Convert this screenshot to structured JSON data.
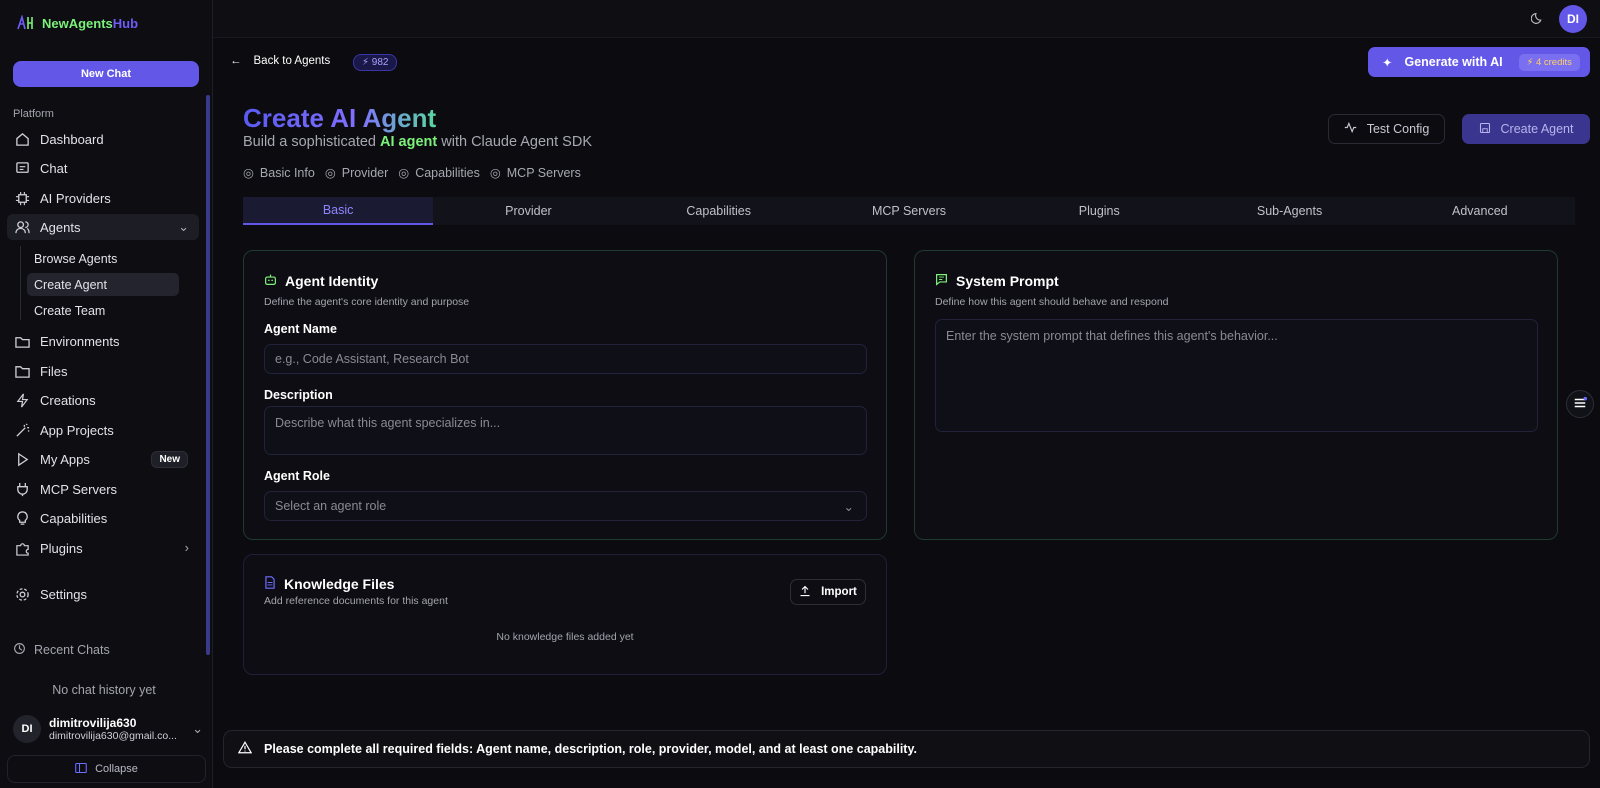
{
  "brand": {
    "part1": "NewAgents",
    "part2": "Hub"
  },
  "sidebar": {
    "new_chat": "New Chat",
    "section": "Platform",
    "items": [
      {
        "label": "Dashboard"
      },
      {
        "label": "Chat"
      },
      {
        "label": "AI Providers"
      },
      {
        "label": "Agents"
      },
      {
        "label": "Environments"
      },
      {
        "label": "Files"
      },
      {
        "label": "Creations"
      },
      {
        "label": "App Projects"
      },
      {
        "label": "My Apps",
        "badge": "New"
      },
      {
        "label": "MCP Servers"
      },
      {
        "label": "Capabilities"
      },
      {
        "label": "Plugins"
      },
      {
        "label": "Settings"
      }
    ],
    "sub_items": [
      {
        "label": "Browse Agents"
      },
      {
        "label": "Create Agent"
      },
      {
        "label": "Create Team"
      }
    ],
    "recent_label": "Recent Chats",
    "no_history": "No chat history yet",
    "user": {
      "initials": "DI",
      "name": "dimitrovilija630",
      "email": "dimitrovilija630@gmail.co..."
    },
    "collapse": "Collapse"
  },
  "topbar": {
    "avatar": "DI"
  },
  "header": {
    "back": "Back to Agents",
    "credit_count": "⚡ 982",
    "generate": "Generate with AI",
    "generate_credits": "4 credits",
    "title": "Create AI Agent",
    "subtitle_pre": "Build a sophisticated ",
    "subtitle_hl": "AI agent",
    "subtitle_post": " with Claude Agent SDK",
    "test_config": "Test Config",
    "create_agent": "Create Agent"
  },
  "steps": [
    "Basic Info",
    "Provider",
    "Capabilities",
    "MCP Servers"
  ],
  "tabs": [
    "Basic",
    "Provider",
    "Capabilities",
    "MCP Servers",
    "Plugins",
    "Sub-Agents",
    "Advanced"
  ],
  "identity": {
    "title": "Agent Identity",
    "sub": "Define the agent's core identity and purpose",
    "name_label": "Agent Name",
    "name_placeholder": "e.g., Code Assistant, Research Bot",
    "desc_label": "Description",
    "desc_placeholder": "Describe what this agent specializes in...",
    "role_label": "Agent Role",
    "role_placeholder": "Select an agent role"
  },
  "prompt": {
    "title": "System Prompt",
    "sub": "Define how this agent should behave and respond",
    "placeholder": "Enter the system prompt that defines this agent's behavior..."
  },
  "knowledge": {
    "title": "Knowledge Files",
    "sub": "Add reference documents for this agent",
    "import": "Import",
    "empty": "No knowledge files added yet"
  },
  "alert": "Please complete all required fields: Agent name, description, role, provider, model, and at least one capability."
}
